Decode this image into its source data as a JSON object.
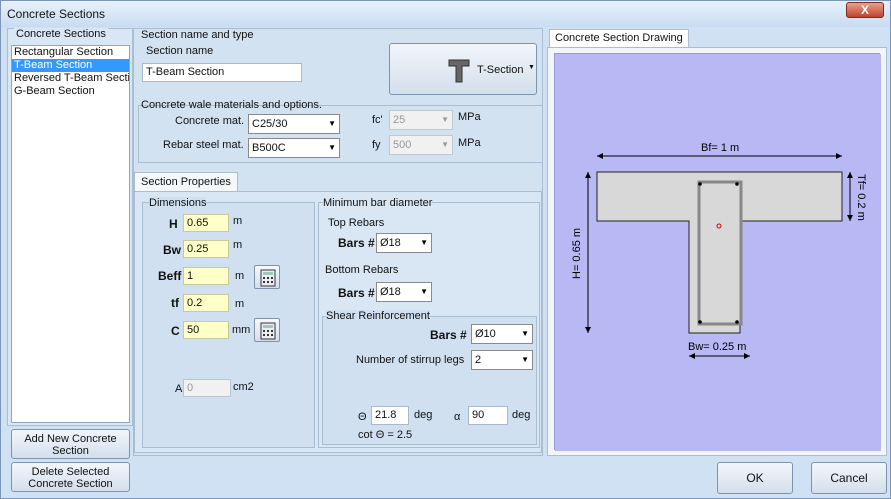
{
  "window": {
    "title": "Concrete Sections",
    "close_glyph": "X"
  },
  "sections_list": {
    "title": "Concrete Sections",
    "items": [
      "Rectangular Section",
      "T-Beam Section",
      "Reversed T-Beam Section",
      "G-Beam Section"
    ],
    "selected_index": 1,
    "add_button": "Add New Concrete Section",
    "delete_button": "Delete Selected Concrete Section"
  },
  "section_name": {
    "group_title": "Section name and type",
    "label": "Section name",
    "value": "T-Beam Section",
    "type_button": "T-Section",
    "type_icon": "t-section-icon"
  },
  "materials": {
    "group_title": "Concrete wale materials and options.",
    "concrete_label": "Concrete mat.",
    "concrete_value": "C25/30",
    "fc_label": "fc'",
    "fc_value": "25",
    "fc_unit": "MPa",
    "rebar_label": "Rebar steel mat.",
    "rebar_value": "B500C",
    "fy_label": "fy",
    "fy_value": "500",
    "fy_unit": "MPa"
  },
  "properties_tab": {
    "label": "Section Properties"
  },
  "dimensions": {
    "group_title": "Dimensions",
    "H": {
      "label": "H",
      "value": "0.65",
      "unit": "m"
    },
    "Bw": {
      "label": "Bw",
      "value": "0.25",
      "unit": "m"
    },
    "Beff": {
      "label": "Beff",
      "value": "1",
      "unit": "m"
    },
    "tf": {
      "label": "tf",
      "value": "0.2",
      "unit": "m"
    },
    "C": {
      "label": "C",
      "value": "50",
      "unit": "mm"
    },
    "A": {
      "label": "A",
      "value": "0",
      "unit": "cm2"
    }
  },
  "bars": {
    "group_title": "Minimum bar diameter",
    "top_title": "Top Rebars",
    "top_label": "Bars #",
    "top_value": "Ø18",
    "bottom_title": "Bottom Rebars",
    "bottom_label": "Bars #",
    "bottom_value": "Ø18"
  },
  "shear": {
    "group_title": "Shear Reinforcement",
    "bars_label": "Bars #",
    "bars_value": "Ø10",
    "legs_label": "Number of stirrup legs",
    "legs_value": "2",
    "theta_symbol": "Θ",
    "theta_value": "21.8",
    "theta_unit": "deg",
    "alpha_symbol": "α",
    "alpha_value": "90",
    "alpha_unit": "deg",
    "cot_text": "cot Θ  = 2.5"
  },
  "drawing": {
    "tab_label": "Concrete Section Drawing",
    "bg_color": "#b8b8f4",
    "bf_label": "Bf= 1 m",
    "h_label": "H= 0.65 m",
    "tf_label": "Tf= 0.2 m",
    "bw_label": "Bw= 0.25 m"
  },
  "footer": {
    "ok": "OK",
    "cancel": "Cancel"
  }
}
